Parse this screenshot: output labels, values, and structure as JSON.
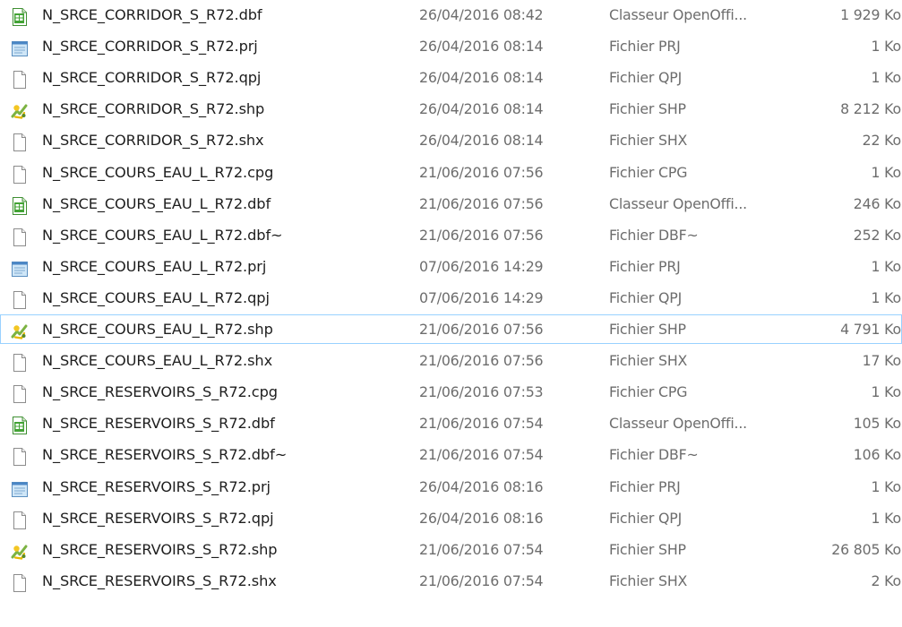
{
  "files": [
    {
      "name": "N_SRCE_CORRIDOR_S_R72.dbf",
      "date": "26/04/2016 08:42",
      "type": "Classeur OpenOffi...",
      "size": "1 929 Ko",
      "icon": "spreadsheet-icon"
    },
    {
      "name": "N_SRCE_CORRIDOR_S_R72.prj",
      "date": "26/04/2016 08:14",
      "type": "Fichier PRJ",
      "size": "1 Ko",
      "icon": "notepad-icon"
    },
    {
      "name": "N_SRCE_CORRIDOR_S_R72.qpj",
      "date": "26/04/2016 08:14",
      "type": "Fichier QPJ",
      "size": "1 Ko",
      "icon": "blank-file-icon"
    },
    {
      "name": "N_SRCE_CORRIDOR_S_R72.shp",
      "date": "26/04/2016 08:14",
      "type": "Fichier SHP",
      "size": "8 212 Ko",
      "icon": "qgis-icon"
    },
    {
      "name": "N_SRCE_CORRIDOR_S_R72.shx",
      "date": "26/04/2016 08:14",
      "type": "Fichier SHX",
      "size": "22 Ko",
      "icon": "blank-file-icon"
    },
    {
      "name": "N_SRCE_COURS_EAU_L_R72.cpg",
      "date": "21/06/2016 07:56",
      "type": "Fichier CPG",
      "size": "1 Ko",
      "icon": "blank-file-icon"
    },
    {
      "name": "N_SRCE_COURS_EAU_L_R72.dbf",
      "date": "21/06/2016 07:56",
      "type": "Classeur OpenOffi...",
      "size": "246 Ko",
      "icon": "spreadsheet-icon"
    },
    {
      "name": "N_SRCE_COURS_EAU_L_R72.dbf~",
      "date": "21/06/2016 07:56",
      "type": "Fichier DBF~",
      "size": "252 Ko",
      "icon": "blank-file-icon"
    },
    {
      "name": "N_SRCE_COURS_EAU_L_R72.prj",
      "date": "07/06/2016 14:29",
      "type": "Fichier PRJ",
      "size": "1 Ko",
      "icon": "notepad-icon"
    },
    {
      "name": "N_SRCE_COURS_EAU_L_R72.qpj",
      "date": "07/06/2016 14:29",
      "type": "Fichier QPJ",
      "size": "1 Ko",
      "icon": "blank-file-icon"
    },
    {
      "name": "N_SRCE_COURS_EAU_L_R72.shp",
      "date": "21/06/2016 07:56",
      "type": "Fichier SHP",
      "size": "4 791 Ko",
      "icon": "qgis-icon",
      "focused": true
    },
    {
      "name": "N_SRCE_COURS_EAU_L_R72.shx",
      "date": "21/06/2016 07:56",
      "type": "Fichier SHX",
      "size": "17 Ko",
      "icon": "blank-file-icon"
    },
    {
      "name": "N_SRCE_RESERVOIRS_S_R72.cpg",
      "date": "21/06/2016 07:53",
      "type": "Fichier CPG",
      "size": "1 Ko",
      "icon": "blank-file-icon"
    },
    {
      "name": "N_SRCE_RESERVOIRS_S_R72.dbf",
      "date": "21/06/2016 07:54",
      "type": "Classeur OpenOffi...",
      "size": "105 Ko",
      "icon": "spreadsheet-icon"
    },
    {
      "name": "N_SRCE_RESERVOIRS_S_R72.dbf~",
      "date": "21/06/2016 07:54",
      "type": "Fichier DBF~",
      "size": "106 Ko",
      "icon": "blank-file-icon"
    },
    {
      "name": "N_SRCE_RESERVOIRS_S_R72.prj",
      "date": "26/04/2016 08:16",
      "type": "Fichier PRJ",
      "size": "1 Ko",
      "icon": "notepad-icon"
    },
    {
      "name": "N_SRCE_RESERVOIRS_S_R72.qpj",
      "date": "26/04/2016 08:16",
      "type": "Fichier QPJ",
      "size": "1 Ko",
      "icon": "blank-file-icon"
    },
    {
      "name": "N_SRCE_RESERVOIRS_S_R72.shp",
      "date": "21/06/2016 07:54",
      "type": "Fichier SHP",
      "size": "26 805 Ko",
      "icon": "qgis-icon"
    },
    {
      "name": "N_SRCE_RESERVOIRS_S_R72.shx",
      "date": "21/06/2016 07:54",
      "type": "Fichier SHX",
      "size": "2 Ko",
      "icon": "blank-file-icon"
    }
  ],
  "colors": {
    "focus_border": "#99d1ff",
    "secondary_text": "#6d6d6d",
    "primary_text": "#1e1e1e"
  }
}
